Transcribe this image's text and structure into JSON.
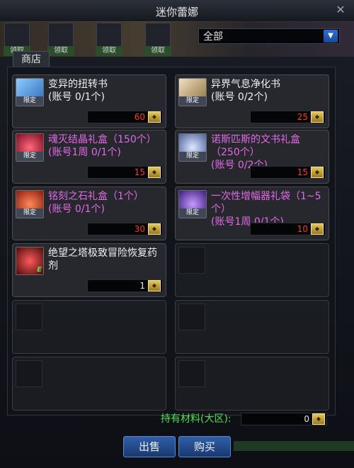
{
  "window": {
    "title": "迷你蕾娜"
  },
  "top_slots": [
    "领取",
    "领取",
    "领取",
    "领取"
  ],
  "filter": {
    "selected": "全部"
  },
  "tab": {
    "label": "商店"
  },
  "items": [
    {
      "name": "变异的扭转书",
      "limit": "(账号 0/1个)",
      "price": "60",
      "badge": "限定",
      "color": "white",
      "icon_color": "#5aa0e0"
    },
    {
      "name": "异界气息净化书",
      "limit": "(账号 0/2个)",
      "price": "25",
      "badge": "限定",
      "color": "white",
      "icon_color": "#c9b48a"
    },
    {
      "name": "魂灭结晶礼盒（150个）",
      "limit": "(账号1周 0/1个)",
      "price": "15",
      "badge": "限定",
      "color": "pink",
      "icon_color": "#c02a4a"
    },
    {
      "name": "诺斯匹斯的文书礼盒（250个）",
      "limit": "(账号 0/2个)",
      "price": "15",
      "badge": "限定",
      "color": "pink",
      "icon_color": "#8fa6d6"
    },
    {
      "name": "铭刻之石礼盒（1个）",
      "limit": "(账号 0/1个)",
      "price": "30",
      "badge": "限定",
      "color": "pink",
      "icon_color": "#d03a2a"
    },
    {
      "name": "一次性增幅器礼袋（1~5个）",
      "limit": "(账号1周 0/1个)",
      "price": "10",
      "badge": "限定",
      "color": "pink",
      "icon_color": "#7a4ac0"
    },
    {
      "name": "绝望之塔极致冒险恢复药剂",
      "limit": "",
      "price": "1",
      "badge": "",
      "color": "white",
      "icon_color": "#c03030"
    }
  ],
  "currency": {
    "label": "持有材料(大区):",
    "amount": "0"
  },
  "buttons": {
    "sell": "出售",
    "buy": "购买"
  }
}
